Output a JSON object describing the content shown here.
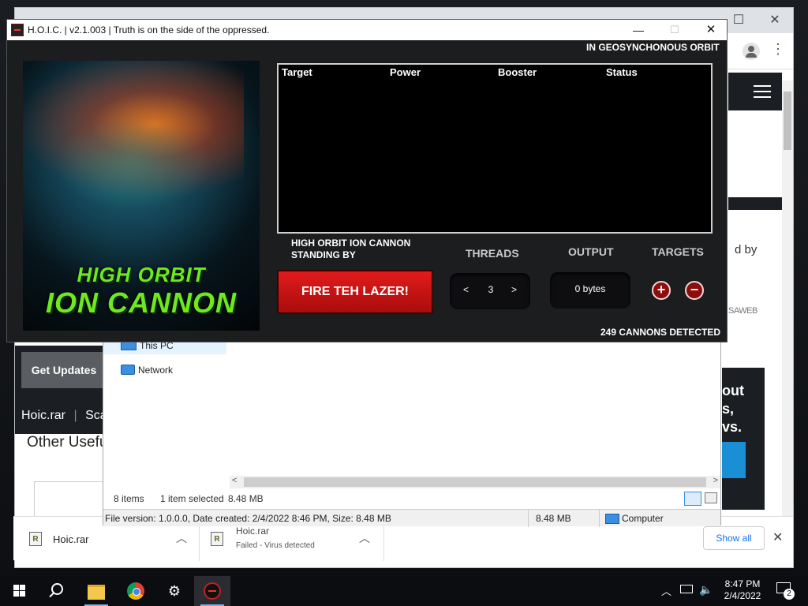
{
  "browser": {
    "right_panel_text": "d by",
    "brand_logo_text": "SAWEB",
    "promo_lines": [
      "out",
      "s,",
      "vs."
    ],
    "get_updates_label": "Get Updates",
    "breadcrumb_file": "Hoic.rar",
    "breadcrumb_next": "Sca",
    "other_useful": "Other Usefu"
  },
  "downloads_bar": {
    "items": [
      {
        "name": "Hoic.rar",
        "status": ""
      },
      {
        "name": "Hoic.rar",
        "status": "Failed - Virus detected"
      }
    ],
    "show_all_label": "Show all"
  },
  "explorer": {
    "nav_items": [
      {
        "label": "This PC",
        "icon": "computer-icon"
      },
      {
        "label": "Network",
        "icon": "network-icon"
      }
    ],
    "status": {
      "items_count": "8 items",
      "selected": "1 item selected",
      "selected_size": "8.48 MB"
    },
    "details": {
      "info": "File version: 1.0.0.0, Date created: 2/4/2022 8:46 PM, Size: 8.48 MB",
      "size": "8.48 MB",
      "location": "Computer"
    }
  },
  "hoic": {
    "title": "H.O.I.C. | v2.1.003 | Truth is on the side of the oppressed.",
    "orbit_status": "IN GEOSYNCHONOUS ORBIT",
    "poster_line1": "HIGH ORBIT",
    "poster_line2": "ION CANNON",
    "table_columns": [
      "Target",
      "Power",
      "Booster",
      "Status"
    ],
    "cannon_status_line1": "HIGH ORBIT ION CANNON",
    "cannon_status_line2": "STANDING BY",
    "fire_button": "FIRE TEH LAZER!",
    "threads_label": "THREADS",
    "threads_value": "3",
    "threads_dec": "<",
    "threads_inc": ">",
    "output_label": "OUTPUT",
    "output_value": "0 bytes",
    "targets_label": "TARGETS",
    "add_target": "+",
    "remove_target": "−",
    "cannons_detected": "249 CANNONS DETECTED",
    "colors": {
      "fire": "#d01414",
      "accent_green": "#6ee81f"
    }
  },
  "taskbar": {
    "apps": [
      "windows-start-icon",
      "search-icon",
      "file-explorer-icon",
      "chrome-icon",
      "settings-icon",
      "hoic-icon"
    ],
    "clock_time": "8:47 PM",
    "clock_date": "2/4/2022",
    "notification_count": "2"
  }
}
